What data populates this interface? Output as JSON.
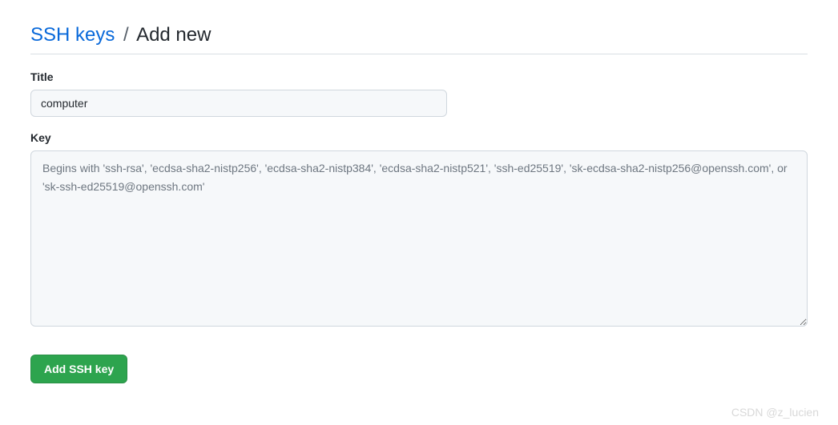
{
  "breadcrumb": {
    "root": "SSH keys",
    "separator": "/",
    "current": "Add new"
  },
  "form": {
    "title": {
      "label": "Title",
      "value": "computer"
    },
    "key": {
      "label": "Key",
      "placeholder": "Begins with 'ssh-rsa', 'ecdsa-sha2-nistp256', 'ecdsa-sha2-nistp384', 'ecdsa-sha2-nistp521', 'ssh-ed25519', 'sk-ecdsa-sha2-nistp256@openssh.com', or 'sk-ssh-ed25519@openssh.com'",
      "value": ""
    },
    "submit_label": "Add SSH key"
  },
  "watermark": "CSDN @z_lucien"
}
